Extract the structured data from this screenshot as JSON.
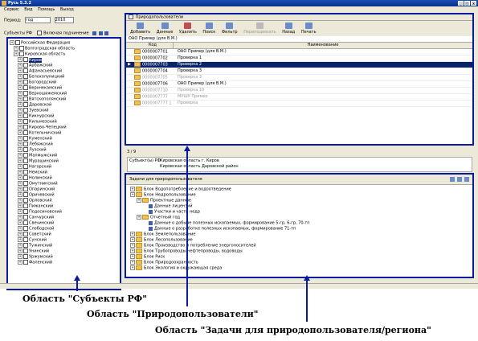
{
  "window": {
    "title": "Русь 5.3.2"
  },
  "menu": [
    "Сервис",
    "Вид",
    "Помощь",
    "Выход"
  ],
  "left": {
    "period_label": "Период:",
    "period_type": "год",
    "period_year": "2010",
    "subjects_label": "Субъекты РФ",
    "include_children": "Включая подчинение",
    "tree": [
      {
        "label": "Российская Федерация",
        "level": 0
      },
      {
        "label": "Волгоградская область",
        "level": 1
      },
      {
        "label": "Кировская область",
        "level": 1
      },
      {
        "label": "Киров",
        "level": 2,
        "selected": true
      },
      {
        "label": "Арбажский",
        "level": 2
      },
      {
        "label": "Афанасьевский",
        "level": 2
      },
      {
        "label": "Белохолуницкий",
        "level": 2
      },
      {
        "label": "Богородский",
        "level": 2
      },
      {
        "label": "Верхнекамский",
        "level": 2
      },
      {
        "label": "Верхошижемский",
        "level": 2
      },
      {
        "label": "Вятскополянский",
        "level": 2
      },
      {
        "label": "Даровской",
        "level": 2
      },
      {
        "label": "Зуевский",
        "level": 2
      },
      {
        "label": "Кикнурский",
        "level": 2
      },
      {
        "label": "Кильмезский",
        "level": 2
      },
      {
        "label": "Кирово-Чепецкий",
        "level": 2
      },
      {
        "label": "Котельничский",
        "level": 2
      },
      {
        "label": "Куменский",
        "level": 2
      },
      {
        "label": "Лебяжский",
        "level": 2
      },
      {
        "label": "Лузский",
        "level": 2
      },
      {
        "label": "Малмыжский",
        "level": 2
      },
      {
        "label": "Мурашинский",
        "level": 2
      },
      {
        "label": "Нагорский",
        "level": 2
      },
      {
        "label": "Немский",
        "level": 2
      },
      {
        "label": "Нолинский",
        "level": 2
      },
      {
        "label": "Омутнинский",
        "level": 2
      },
      {
        "label": "Опаринский",
        "level": 2
      },
      {
        "label": "Оричевский",
        "level": 2
      },
      {
        "label": "Орловский",
        "level": 2
      },
      {
        "label": "Пижанский",
        "level": 2
      },
      {
        "label": "Подосиновский",
        "level": 2
      },
      {
        "label": "Санчурский",
        "level": 2
      },
      {
        "label": "Свечинский",
        "level": 2
      },
      {
        "label": "Слободской",
        "level": 2
      },
      {
        "label": "Советский",
        "level": 2
      },
      {
        "label": "Сунский",
        "level": 2
      },
      {
        "label": "Тужинский",
        "level": 2
      },
      {
        "label": "Унинский",
        "level": 2
      },
      {
        "label": "Уржумский",
        "level": 2
      },
      {
        "label": "Фаленский",
        "level": 2
      }
    ]
  },
  "users": {
    "header": "Природопользователи",
    "toolbar": [
      "Добавить",
      "Данные",
      "Удалить",
      "Поиск",
      "Фильтр",
      "Переподвязать",
      "Назад",
      "Печать"
    ],
    "breadcrumb": "ОАО Пример (для В.М.)",
    "columns": [
      "Код",
      "Наименование"
    ],
    "rows": [
      {
        "code": "0000007701",
        "name": "ОАО Пример (для В.М.)"
      },
      {
        "code": "0000007702",
        "name": "Проверка 1"
      },
      {
        "code": "0000007703",
        "name": "Проверка 2",
        "selected": true
      },
      {
        "code": "0000007704",
        "name": "Проверка 3"
      },
      {
        "code": "0000007705",
        "name": "Проверка 3",
        "faded": true
      },
      {
        "code": "0000007706",
        "name": "ОАО Пример (для В.М.)"
      },
      {
        "code": "0000007710",
        "name": "Проверка 10",
        "faded": true
      },
      {
        "code": "0000007777",
        "name": "МУШУ Пример",
        "faded": true
      },
      {
        "code": "0000007777 1",
        "name": "Проверка",
        "faded": true
      }
    ],
    "count": "3 / 9",
    "subjects_label": "Субъект(ы) РФ",
    "subjects": [
      "Кировская область г. Киров",
      "Кировская область Даровской район"
    ]
  },
  "tasks": {
    "header": "Задачи для природопользователя",
    "tree": [
      {
        "label": "Блок Водопотребление и водоотведение",
        "level": 0,
        "icon": "folder"
      },
      {
        "label": "Блок Недропользование",
        "level": 0,
        "icon": "folder"
      },
      {
        "label": "Проектные данные",
        "level": 1,
        "icon": "folder"
      },
      {
        "label": "Данные лицензий",
        "level": 2,
        "icon": "grid"
      },
      {
        "label": "Участки и части недр",
        "level": 2,
        "icon": "grid"
      },
      {
        "label": "Отчетный год",
        "level": 1,
        "icon": "folder"
      },
      {
        "label": "Данные о добыче полезных ископаемых, формирование 5-гр, 6-гр, 70-тп",
        "level": 2,
        "icon": "grid"
      },
      {
        "label": "Данные о разработке полезных ископаемых, формирование 71-тп",
        "level": 2,
        "icon": "grid"
      },
      {
        "label": "Блок Землепользование",
        "level": 0,
        "icon": "folder"
      },
      {
        "label": "Блок Лесопользование",
        "level": 0,
        "icon": "folder"
      },
      {
        "label": "Блок Производство и потребление энергоносителей",
        "level": 0,
        "icon": "folder"
      },
      {
        "label": "Блок Трубопроводы нефтепроводы, водоводы",
        "level": 0,
        "icon": "folder"
      },
      {
        "label": "Блок Риск",
        "level": 0,
        "icon": "folder"
      },
      {
        "label": "Блок Природоохранность",
        "level": 0,
        "icon": "folder"
      },
      {
        "label": "Блок Экология и окружающая среда",
        "level": 0,
        "icon": "folder"
      }
    ]
  },
  "captions": {
    "subjects": "Область \"Субъекты РФ\"",
    "users": "Область \"Природопользователи\"",
    "tasks": "Область \"Задачи для природопользователя/региона\""
  },
  "colors": {
    "highlight": "#0a1aa0",
    "selection": "#0a246a",
    "chrome": "#ece9d8"
  }
}
